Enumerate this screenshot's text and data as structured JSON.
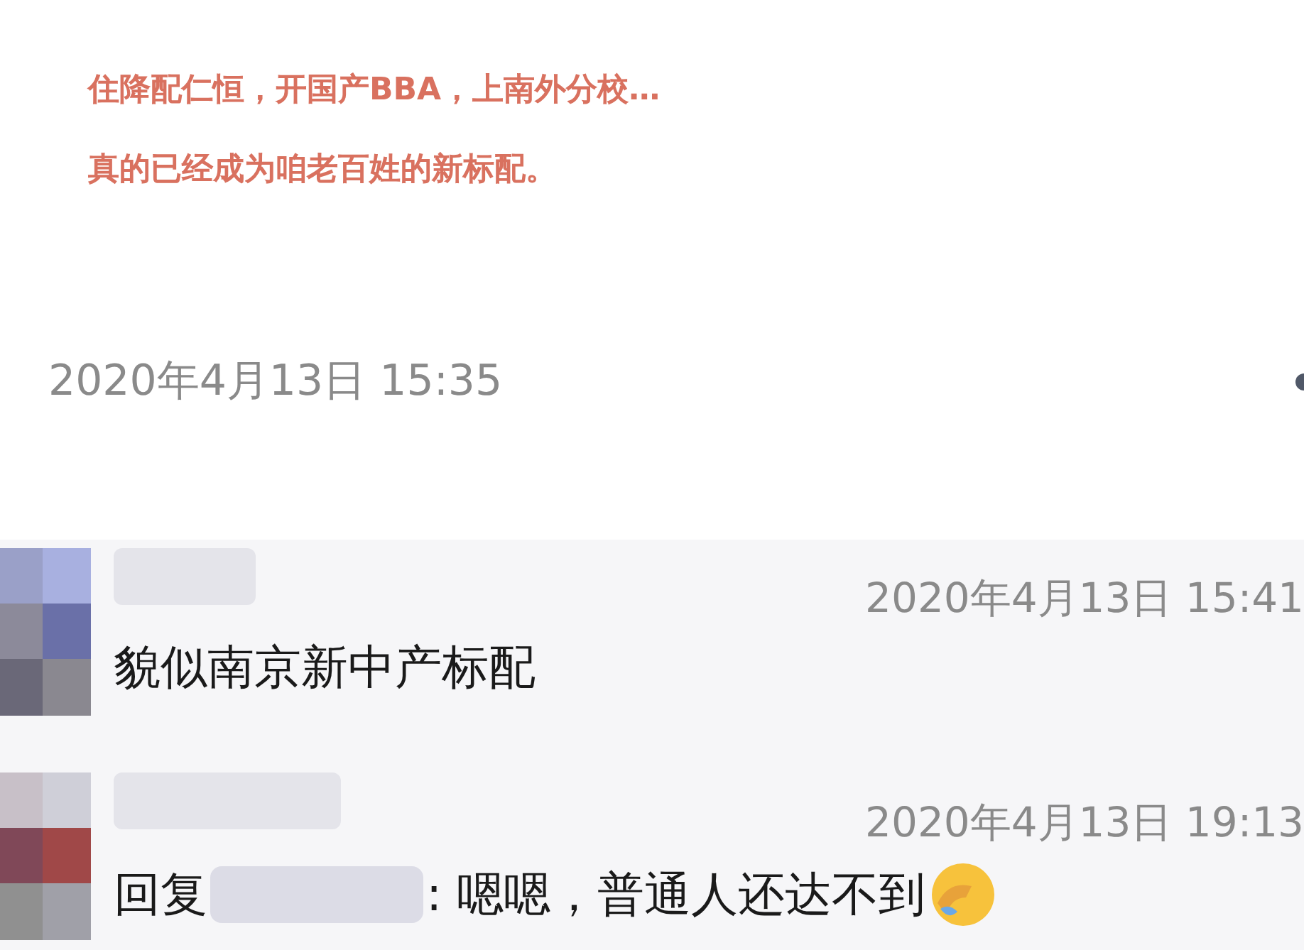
{
  "article": {
    "lines": [
      "住降配仁恒，开国产BBA，上南外分校…",
      "真的已经成为咱老百姓的新标配。"
    ],
    "date": "2020年4月13日 15:35"
  },
  "comments": [
    {
      "kind": "comment",
      "time": "2020年4月13日 15:41",
      "text": "貌似南京新中产标配"
    },
    {
      "kind": "reply",
      "reply_label": "回复",
      "time": "2020年4月13日 19:13",
      "text": ": 嗯嗯，普通人还达不到"
    }
  ]
}
